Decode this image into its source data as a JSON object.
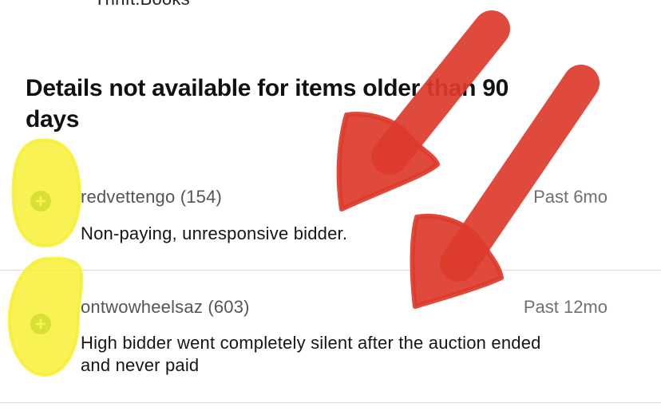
{
  "clipped_header_text": "Thrift.Books",
  "section_title": "Details not available for items older than 90 days",
  "feedback": [
    {
      "username": "redvettengo (154)",
      "time": "Past 6mo",
      "comment": "Non-paying, unresponsive bidder."
    },
    {
      "username": "ontwowheelsaz (603)",
      "time": "Past 12mo",
      "comment": "High bidder went completely silent after the auction ended and never paid"
    }
  ],
  "icons": {
    "expand": "plus-circle-icon"
  },
  "colors": {
    "expand_icon": "#4d9d45",
    "highlighter_yellow": "#f6ef2f",
    "annotation_arrow_red": "#dc3b2b",
    "divider": "#dedede",
    "username_text": "#555555",
    "timestamp_text": "#707070"
  }
}
